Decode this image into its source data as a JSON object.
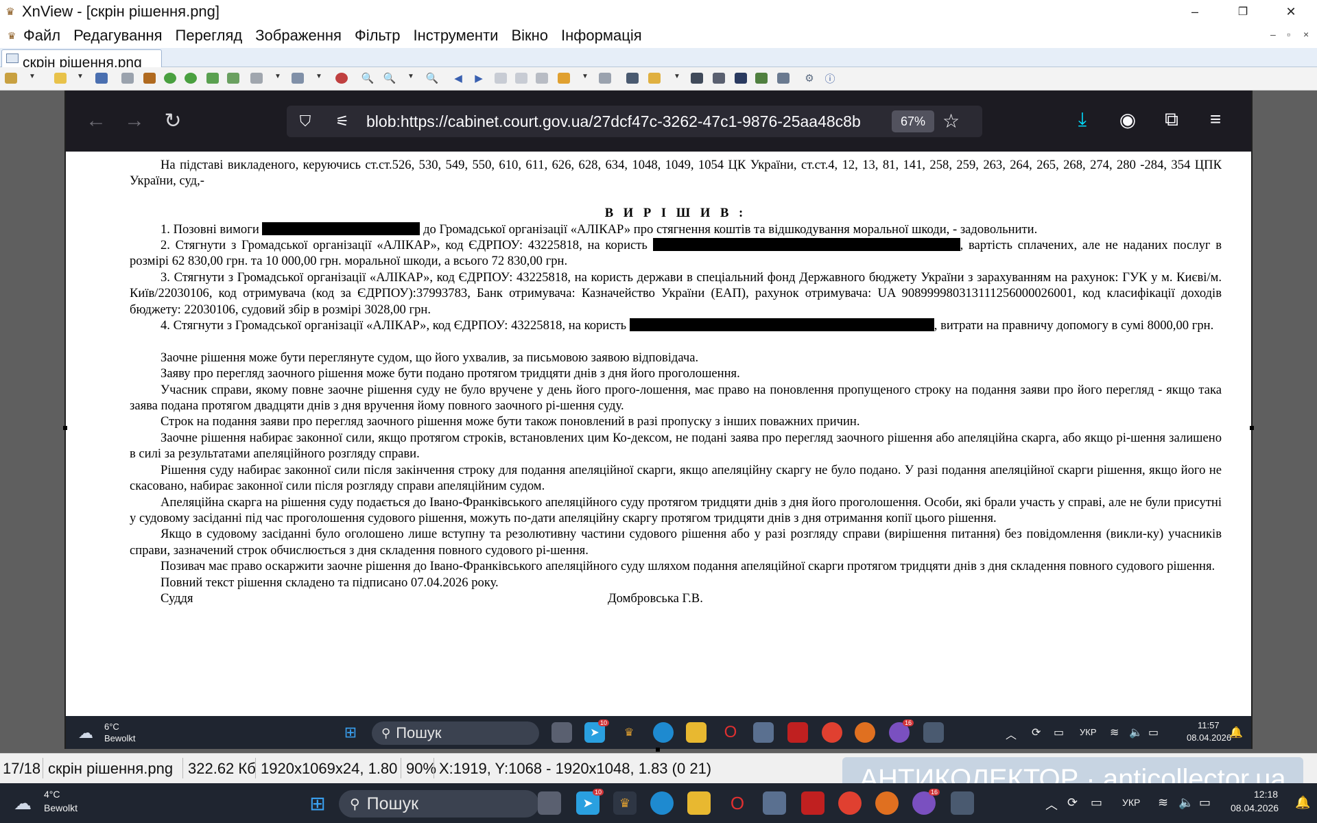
{
  "window": {
    "title": "XnView - [скрін рішення.png]",
    "controls": [
      "–",
      "❐",
      "✕"
    ]
  },
  "menu": {
    "items": [
      "Файл",
      "Редагування",
      "Перегляд",
      "Зображення",
      "Фільтр",
      "Інструменти",
      "Вікно",
      "Інформація"
    ],
    "mdi_controls": [
      "–",
      "▫",
      "×"
    ]
  },
  "tab": {
    "label": "скрін рішення.png"
  },
  "browser": {
    "url": "blob:https://cabinet.court.gov.ua/27dcf47c-3262-47c1-9876-25aa48c8b",
    "zoom": "67%"
  },
  "document": {
    "intro": "На підставі викладеного, керуючись ст.ст.526, 530, 549, 550, 610, 611, 626, 628, 634, 1048, 1049, 1054 ЦК України, ст.ст.4, 12, 13, 81, 141, 258, 259, 263, 264, 265, 268, 274, 280 -284, 354 ЦПК України, суд,-",
    "heading": "В И Р І Ш И В :",
    "p1_a": "1. Позовні вимоги ",
    "p1_b": " до Громадської організації «АЛІКАР» про стягнення коштів та відшкодування моральної шкоди, - задовольнити.",
    "p2_a": "2. Стягнути з Громадської організації «АЛІКАР», код ЄДРПОУ: 43225818, на користь ",
    "p2_b": ", вартість сплачених, але не наданих послуг в розмірі 62 830,00 грн. та 10 000,00 грн. моральної шкоди, а всього 72 830,00 грн.",
    "p3": "3. Стягнути з Громадської організації «АЛІКАР», код ЄДРПОУ: 43225818, на користь держави в спеціальний фонд Державного бюджету України з зарахуванням на рахунок: ГУК у м. Києві/м. Київ/22030106, код отримувача (код за ЄДРПОУ):37993783, Банк отримувача: Казначейство України (ЕАП), рахунок отримувача: UA 908999980313111256000026001, код класифікації доходів бюджету: 22030106, судовий збір в розмірі 3028,00 грн.",
    "p4_a": "4. Стягнути з Громадської організації «АЛІКАР», код ЄДРПОУ: 43225818, на користь ",
    "p4_b": ", витрати на правничу допомогу в сумі 8000,00 грн.",
    "paragraphs": [
      "Заочне рішення може бути переглянуте судом, що його ухвалив, за письмовою заявою відповідача.",
      "Заяву про перегляд заочного рішення може бути подано протягом тридцяти днів з дня його проголошення.",
      "Учасник справи, якому повне заочне рішення суду не було вручене у день його прого-лошення, має право на поновлення пропущеного строку на подання заяви про його перегляд - якщо така заява подана протягом двадцяти днів з дня вручення йому повного заочного рі-шення суду.",
      "Строк на подання заяви про перегляд заочного рішення може бути також поновлений в разі пропуску з інших поважних причин.",
      "Заочне рішення набирає законної сили, якщо протягом строків, встановлених цим Ко-дексом, не подані заява про перегляд заочного рішення або апеляційна скарга, або якщо рі-шення залишено в силі за результатами апеляційного розгляду справи.",
      "Рішення суду набирає законної сили після закінчення строку для подання апеляційної скарги, якщо апеляційну скаргу не було подано. У разі подання апеляційної скарги рішення, якщо його не скасовано, набирає законної сили після розгляду справи апеляційним судом.",
      "Апеляційна скарга на рішення суду подається до Івано-Франківського апеляційного суду протягом тридцяти днів з дня його проголошення. Особи, які брали участь у справі, але не були присутні у судовому засіданні під час проголошення судового рішення, можуть по-дати апеляційну скаргу протягом тридцяти днів з дня отримання копії цього рішення.",
      "Якщо в судовому засіданні було оголошено лише вступну та резолютивну частини судового рішення або у разі розгляду справи (вирішення питання) без повідомлення (викли-ку) учасників справи, зазначений строк обчислюється з дня складення повного судового рі-шення.",
      "Позивач має право оскаржити заочне рішення до Івано-Франківського апеляційного суду шляхом подання апеляційної скарги протягом тридцяти днів з дня складення повного судового рішення.",
      "Повний текст рішення складено та підписано 07.04.2026 року."
    ],
    "judge_label": "Суддя",
    "judge_name": "Домбровська Г.В."
  },
  "inner_taskbar": {
    "temp": "6°C",
    "weather": "Bewolkt",
    "search": "Пошук",
    "lang": "УКР",
    "time": "11:57",
    "date": "08.04.2026",
    "badge1": "10",
    "badge2": "16"
  },
  "statusbar": {
    "index": "17/18",
    "filename": "скрін рішення.png",
    "size": "322.62 Кб",
    "dims": "1920x1069x24, 1.80",
    "zoom": "90%",
    "coords": "X:1919, Y:1068 - 1920x1048, 1.83 (0 21)"
  },
  "watermark": "АНТИКОЛЕКТОР · anticollector.ua",
  "taskbar": {
    "temp": "4°C",
    "weather": "Bewolkt",
    "search": "Пошук",
    "lang": "УКР",
    "time": "12:18",
    "date": "08.04.2026",
    "badge1": "10",
    "badge2": "16"
  }
}
